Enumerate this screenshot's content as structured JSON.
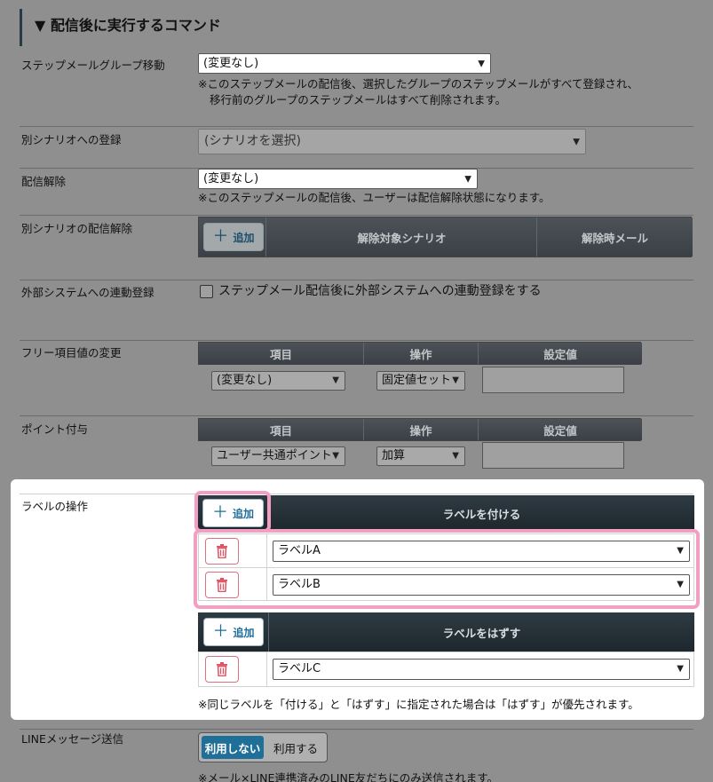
{
  "section": {
    "title": "▼ 配信後に実行するコマンド"
  },
  "step_group": {
    "label": "ステップメールグループ移動",
    "value": "(変更なし)",
    "note_line1": "※このステップメールの配信後、選択したグループのステップメールがすべて登録され、",
    "note_line2": "移行前のグループのステップメールはすべて削除されます。"
  },
  "scenario_register": {
    "label": "別シナリオへの登録",
    "placeholder": "(シナリオを選択)"
  },
  "unsubscribe": {
    "label": "配信解除",
    "value": "(変更なし)",
    "note": "※このステップメールの配信後、ユーザーは配信解除状態になります。"
  },
  "scenario_unsubscribe": {
    "label": "別シナリオの配信解除",
    "add_label": "追加",
    "col_scenario": "解除対象シナリオ",
    "col_mail": "解除時メール"
  },
  "external": {
    "label": "外部システムへの連動登録",
    "checkbox_label": "ステップメール配信後に外部システムへの連動登録をする"
  },
  "free_item": {
    "label": "フリー項目値の変更",
    "col_item": "項目",
    "col_op": "操作",
    "col_value": "設定値",
    "item_value": "(変更なし)",
    "op_value": "固定値セット"
  },
  "points": {
    "label": "ポイント付与",
    "col_item": "項目",
    "col_op": "操作",
    "col_value": "設定値",
    "item_value": "ユーザー共通ポイント",
    "op_value": "加算"
  },
  "label_ops": {
    "label": "ラベルの操作",
    "add_label": "追加",
    "attach_header": "ラベルを付ける",
    "attach_rows": [
      "ラベルA",
      "ラベルB"
    ],
    "remove_header": "ラベルをはずす",
    "remove_rows": [
      "ラベルC"
    ],
    "note": "※同じラベルを「付ける」と「はずす」に指定された場合は「はずす」が優先されます。"
  },
  "line_message": {
    "label": "LINEメッセージ送信",
    "off_label": "利用しない",
    "on_label": "利用する",
    "note": "※メール×LINE連携済みのLINE友だちにのみ送信されます。"
  },
  "colors": {
    "accent": "#1f6f98",
    "highlight": "#f29fc1",
    "danger": "#e05060"
  }
}
